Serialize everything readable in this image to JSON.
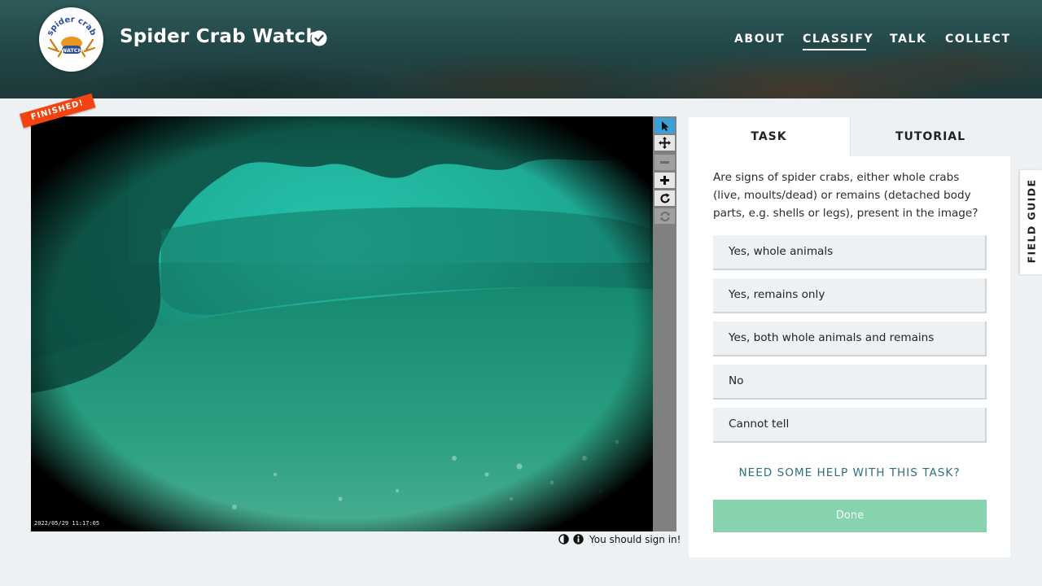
{
  "header": {
    "project_title": "Spider Crab Watch",
    "logo_text_top": "spider crab",
    "logo_text_bottom": "WATCH",
    "nav": [
      {
        "label": "ABOUT",
        "active": false
      },
      {
        "label": "CLASSIFY",
        "active": true
      },
      {
        "label": "TALK",
        "active": false
      },
      {
        "label": "COLLECT",
        "active": false
      }
    ]
  },
  "viewer": {
    "badge": "FINISHED!",
    "timestamp": "2022/05/29 11:17:05",
    "tools": [
      {
        "name": "pointer-icon",
        "state": "active"
      },
      {
        "name": "pan-icon",
        "state": "light"
      },
      {
        "name": "zoom-out-icon",
        "state": "gray"
      },
      {
        "name": "zoom-in-icon",
        "state": "light"
      },
      {
        "name": "rotate-icon",
        "state": "light"
      },
      {
        "name": "reset-icon",
        "state": "gray"
      }
    ],
    "sign_in_notice": "You should sign in!"
  },
  "task_panel": {
    "tabs": [
      "TASK",
      "TUTORIAL"
    ],
    "active_tab": "TASK",
    "question": "Are signs of spider crabs, either whole crabs (live, moults/dead) or remains (detached body parts, e.g. shells or legs), present in the image?",
    "answers": [
      "Yes, whole animals",
      "Yes, remains only",
      "Yes, both whole animals and remains",
      "No",
      "Cannot tell"
    ],
    "help_link": "NEED SOME HELP WITH THIS TASK?",
    "done_label": "Done"
  },
  "field_guide": {
    "label": "FIELD GUIDE"
  },
  "colors": {
    "accent_link": "#2d6f7d",
    "done_button": "#86d3ae",
    "finished_badge": "#f44310",
    "active_tool": "#3aa1d8"
  }
}
